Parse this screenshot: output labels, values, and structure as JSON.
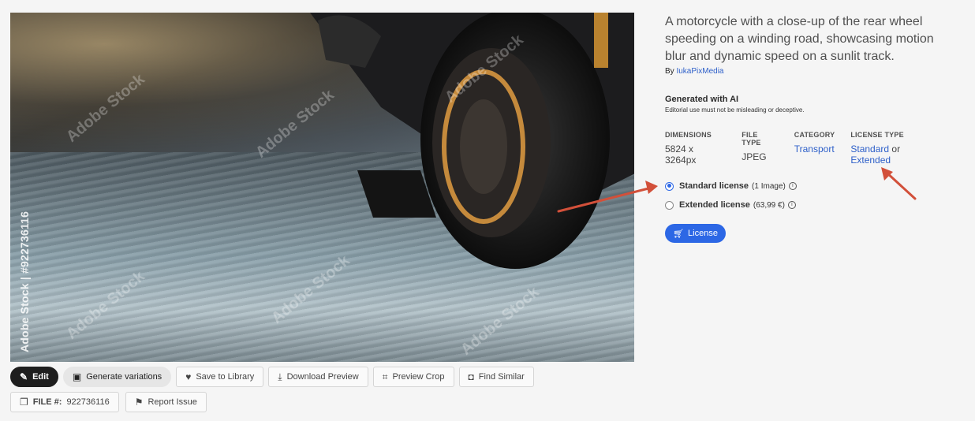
{
  "image": {
    "watermark": "Adobe Stock",
    "side_label": "Adobe Stock | #922736116"
  },
  "toolbar": {
    "edit": "Edit",
    "generate": "Generate variations",
    "save": "Save to Library",
    "download": "Download Preview",
    "crop": "Preview Crop",
    "similar": "Find Similar",
    "file_label": "FILE #:",
    "file_number": "922736116",
    "report": "Report Issue"
  },
  "info": {
    "title": "A motorcycle with a close-up of the rear wheel speeding on a winding road, showcasing motion blur and dynamic speed on a sunlit track.",
    "by": "By",
    "author": "IukaPixMedia",
    "generated": "Generated with AI",
    "editorial_note": "Editorial use must not be misleading or deceptive.",
    "meta": {
      "dimensions_label": "DIMENSIONS",
      "dimensions": "5824 x 3264px",
      "filetype_label": "FILE TYPE",
      "filetype": "JPEG",
      "category_label": "CATEGORY",
      "category": "Transport",
      "license_label": "LICENSE TYPE",
      "license_standard": "Standard",
      "license_or": "or",
      "license_extended": "Extended"
    },
    "options": {
      "standard": "Standard license",
      "standard_note": "(1 Image)",
      "extended": "Extended license",
      "extended_note": "(63,99 €)"
    },
    "license_button": "License"
  },
  "colors": {
    "link": "#2d5fc9",
    "primary": "#2c67e5",
    "annotation_arrow": "#d2503a"
  }
}
